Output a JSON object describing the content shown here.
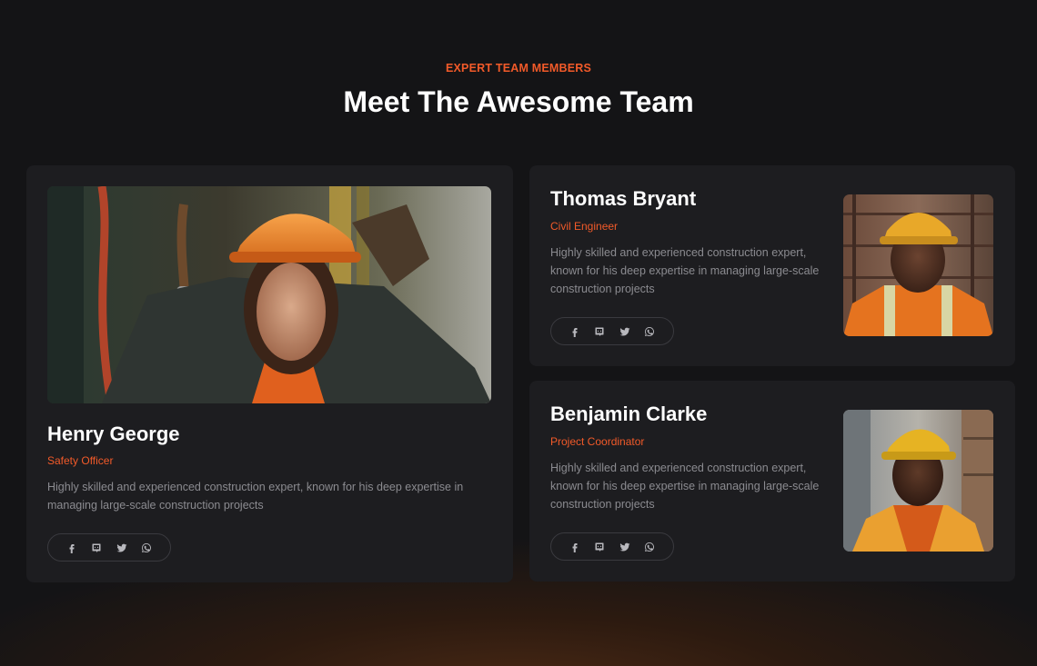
{
  "section": {
    "eyebrow": "EXPERT TEAM MEMBERS",
    "title": "Meet The Awesome Team"
  },
  "members": [
    {
      "name": "Henry George",
      "role": "Safety Officer",
      "bio": "Highly skilled and experienced construction expert, known for his deep expertise in managing large-scale construction projects",
      "socials": [
        "facebook-icon",
        "discord-icon",
        "twitter-icon",
        "whatsapp-icon"
      ]
    },
    {
      "name": "Thomas Bryant",
      "role": "Civil Engineer",
      "bio": "Highly skilled and experienced construction expert, known for his deep expertise in managing large-scale construction projects",
      "socials": [
        "facebook-icon",
        "discord-icon",
        "twitter-icon",
        "whatsapp-icon"
      ]
    },
    {
      "name": "Benjamin Clarke",
      "role": "Project Coordinator",
      "bio": "Highly skilled and experienced construction expert, known for his deep expertise in managing large-scale construction projects",
      "socials": [
        "facebook-icon",
        "discord-icon",
        "twitter-icon",
        "whatsapp-icon"
      ]
    }
  ],
  "colors": {
    "accent": "#f25a29",
    "background": "#141416",
    "card": "#1d1d20",
    "muted_text": "#8b8b90"
  }
}
